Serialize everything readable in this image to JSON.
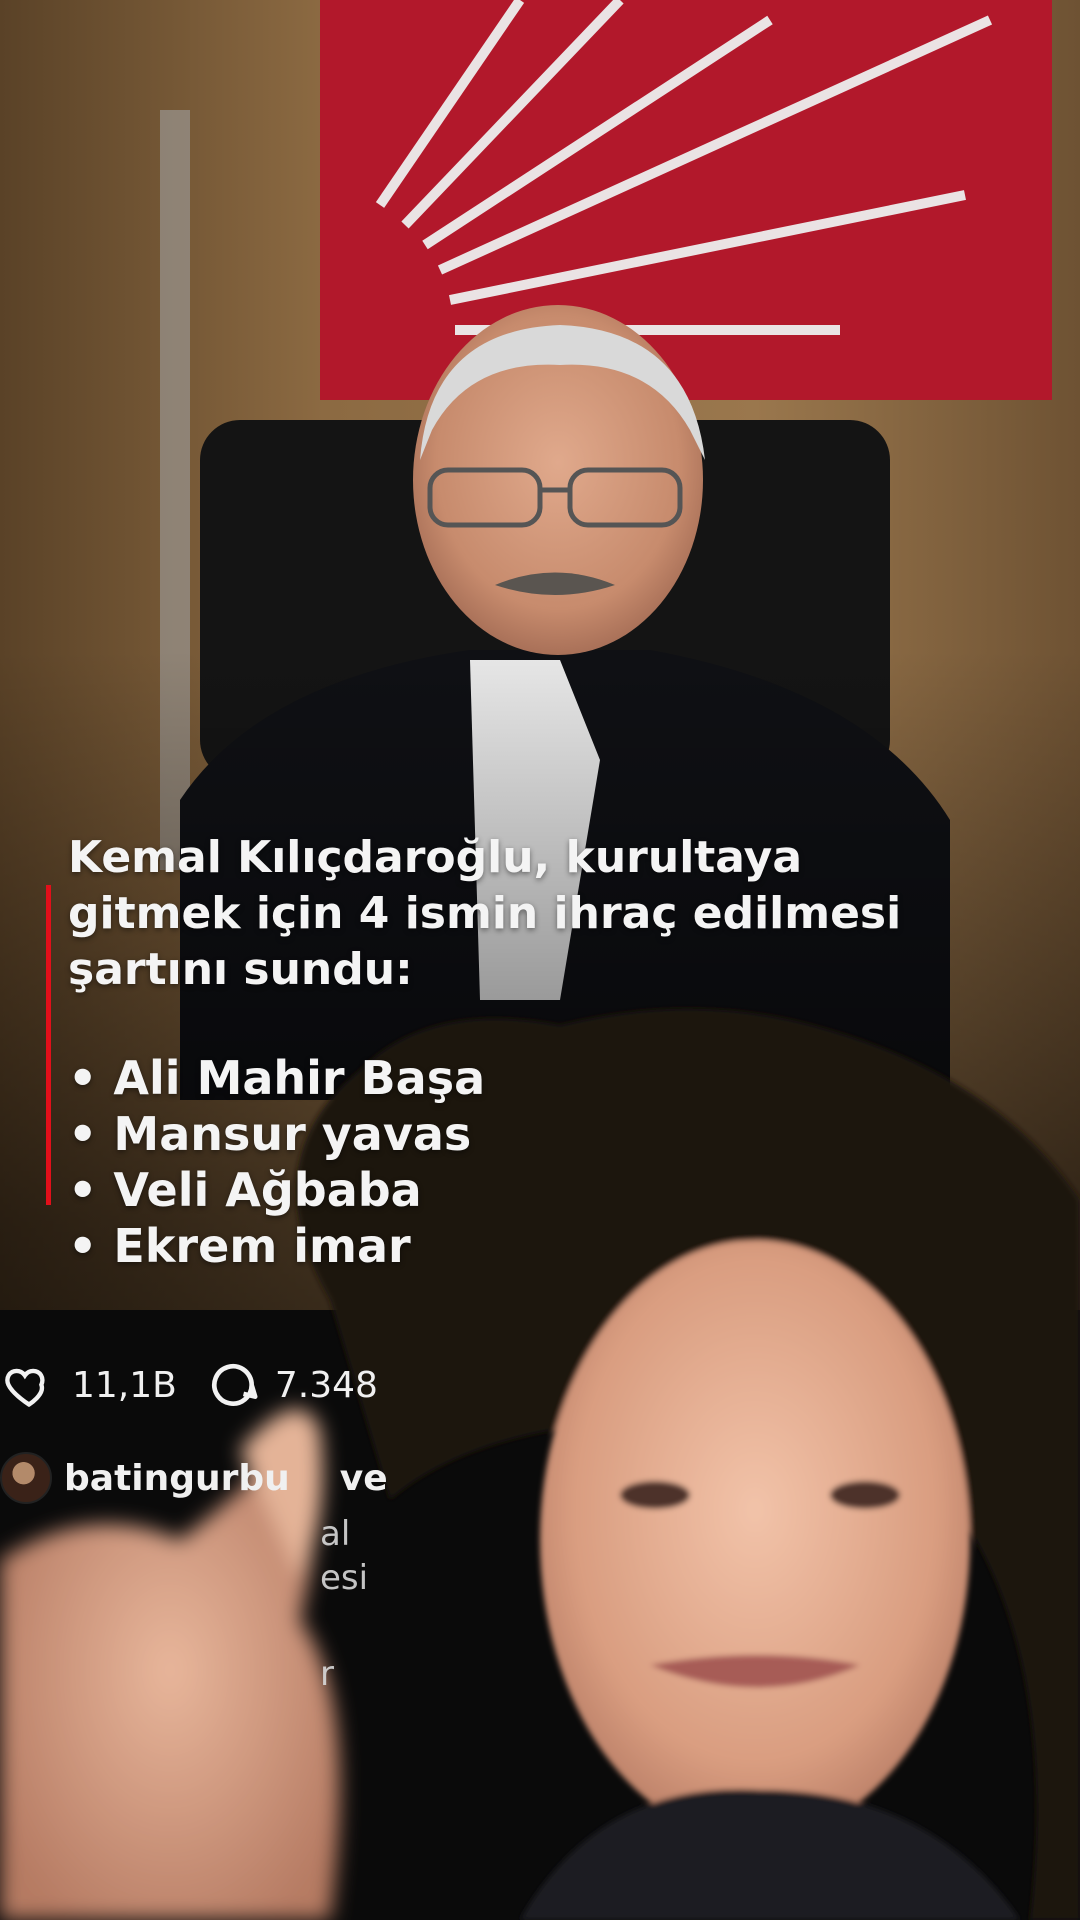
{
  "headline": {
    "line1": "Kemal Kılıçdaroğlu, kurultaya",
    "line2": "gitmek için 4 ismin ihraç edilmesi",
    "line3": "şartını sundu:"
  },
  "bullets": [
    "• Ali Mahir Başa",
    "• Mansur yavas",
    "• Veli Ağbaba",
    "• Ekrem imar"
  ],
  "stats": {
    "likes": "11,1B",
    "comments": "7.348"
  },
  "author": {
    "username": "batingurbu",
    "suffix": "ve"
  },
  "caption_fragments": [
    "al",
    "esi",
    "r"
  ],
  "colors": {
    "accent_red": "#e20f1a",
    "party_red": "#b2182b",
    "background_brown": "#8b6a42"
  },
  "icons": {
    "like": "heart-icon",
    "comment": "comment-bubble-icon"
  }
}
